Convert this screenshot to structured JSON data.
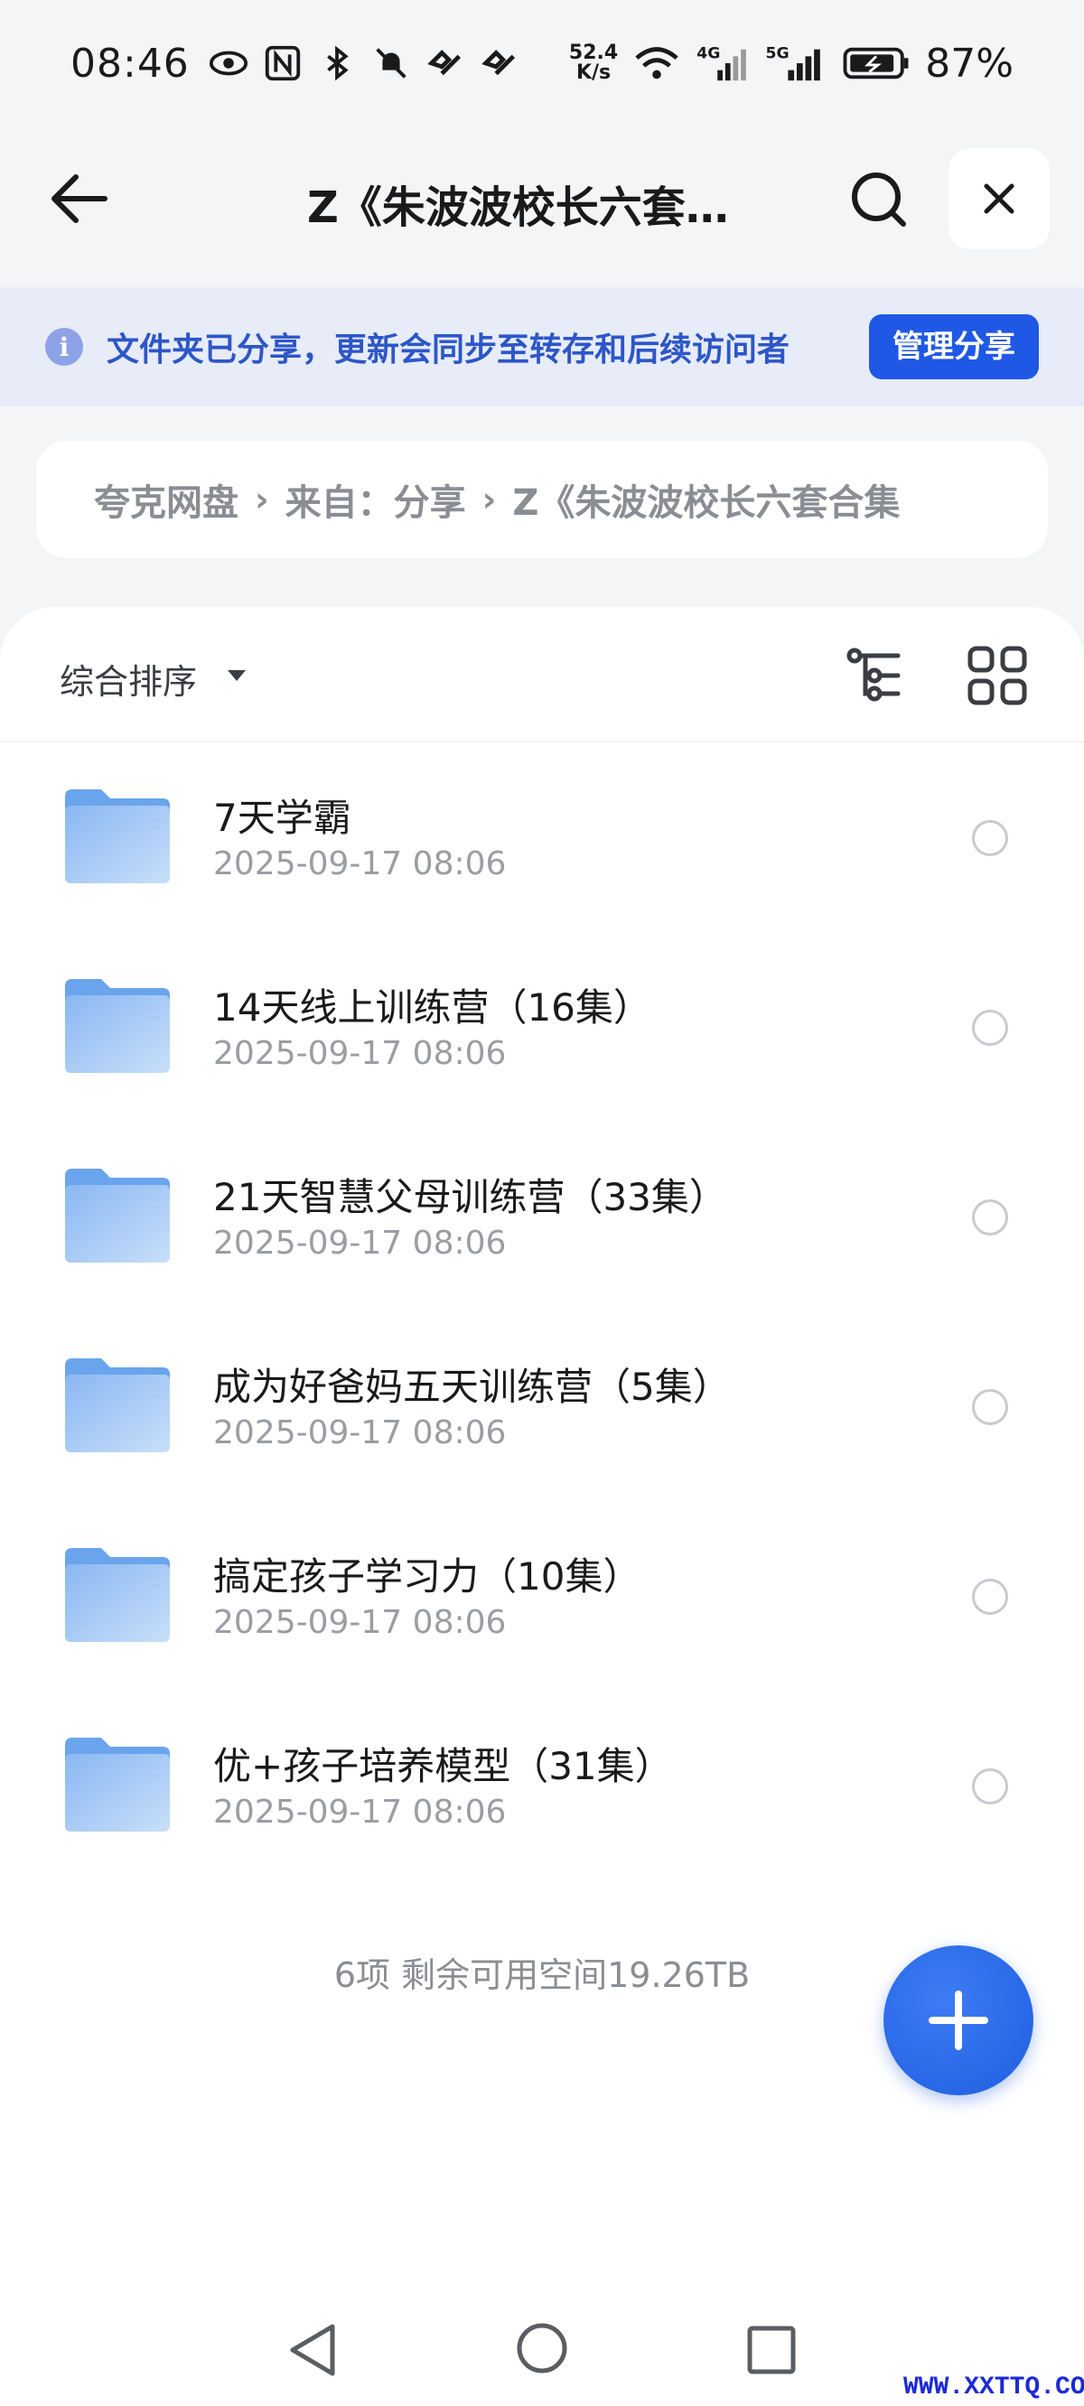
{
  "status_bar": {
    "time": "08:46",
    "net_speed_value": "52.4",
    "net_speed_unit": "K/s",
    "net_4g": "4G",
    "net_5g": "5G",
    "battery": "87%"
  },
  "header": {
    "title": "Z《朱波波校长六套…",
    "back_icon": "arrow-left-icon",
    "search_icon": "search-icon",
    "close_icon": "close-icon"
  },
  "share_banner": {
    "text": "文件夹已分享，更新会同步至转存和后续访问者",
    "button": "管理分享"
  },
  "breadcrumb": {
    "items": [
      "夸克网盘",
      "来自：分享",
      "Z《朱波波校长六套合集"
    ]
  },
  "toolbar": {
    "sort_label": "综合排序"
  },
  "files": [
    {
      "name": "7天学霸",
      "date": "2025-09-17 08:06"
    },
    {
      "name": "14天线上训练营（16集）",
      "date": "2025-09-17 08:06"
    },
    {
      "name": "21天智慧父母训练营（33集）",
      "date": "2025-09-17 08:06"
    },
    {
      "name": "成为好爸妈五天训练营（5集）",
      "date": "2025-09-17 08:06"
    },
    {
      "name": "搞定孩子学习力（10集）",
      "date": "2025-09-17 08:06"
    },
    {
      "name": "优+孩子培养模型（31集）",
      "date": "2025-09-17 08:06"
    }
  ],
  "footer": {
    "info": "6项 剩余可用空间19.26TB"
  },
  "watermark": "WWW.XXTTQ.COM",
  "colors": {
    "accent": "#2058e6",
    "banner_bg": "#e7ecf8",
    "folder": "#7fb0ee"
  }
}
